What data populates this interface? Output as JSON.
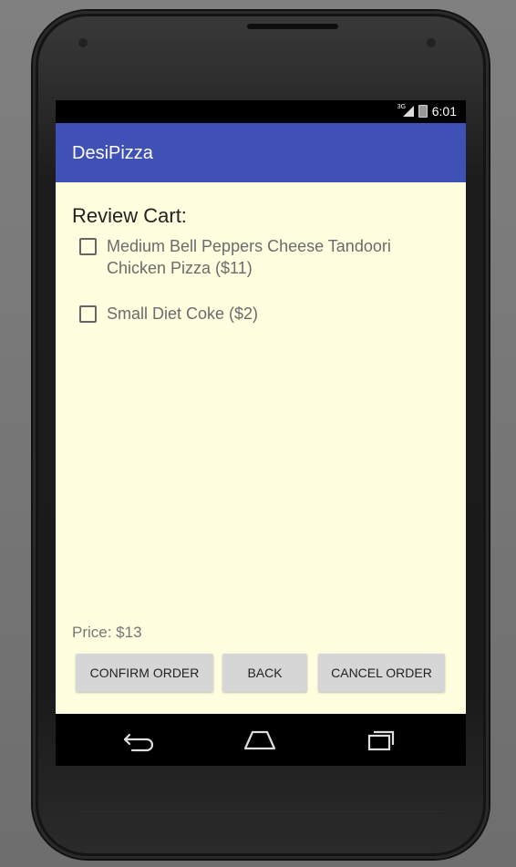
{
  "status_bar": {
    "network": "3G",
    "time": "6:01"
  },
  "app_bar": {
    "title": "DesiPizza"
  },
  "cart": {
    "heading": "Review Cart:",
    "items": [
      {
        "label": "Medium Bell Peppers Cheese Tandoori Chicken Pizza ($11)",
        "checked": false
      },
      {
        "label": "Small Diet Coke ($2)",
        "checked": false
      }
    ],
    "price_label": "Price: $13"
  },
  "actions": {
    "confirm_label": "CONFIRM ORDER",
    "back_label": "BACK",
    "cancel_label": "CANCEL ORDER"
  },
  "navigation": {
    "back_icon": "back-icon",
    "home_icon": "home-icon",
    "recents_icon": "recents-icon"
  },
  "colors": {
    "app_bar": "#3f51b5",
    "content_background": "#ffffe0",
    "button_background": "#d6d6d6"
  }
}
